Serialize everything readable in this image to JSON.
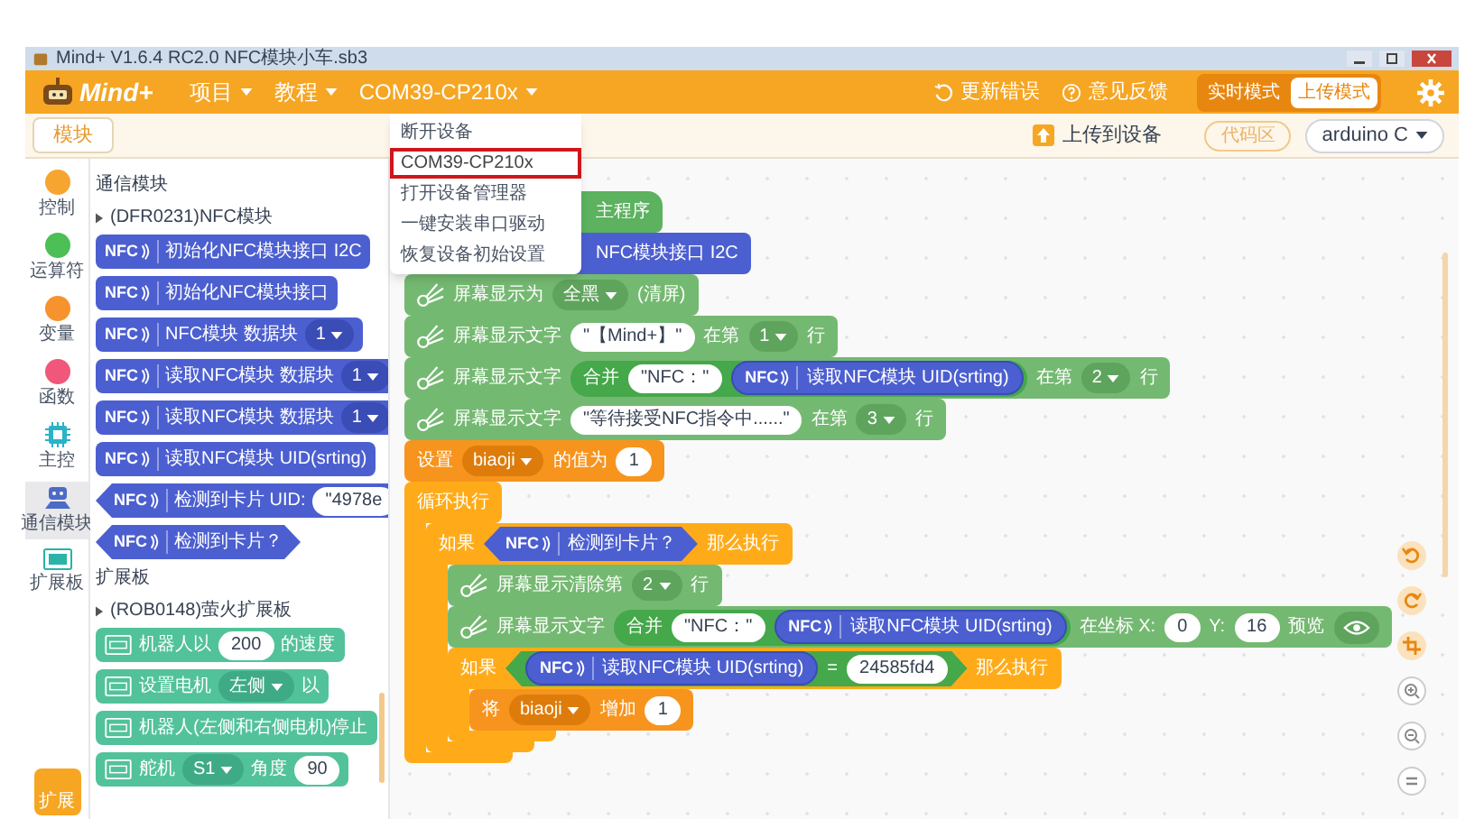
{
  "window": {
    "title": "Mind+ V1.6.4 RC2.0  NFC模块小车.sb3"
  },
  "menu_bar": {
    "logo": "Mind+",
    "items": [
      {
        "label": "项目"
      },
      {
        "label": "教程"
      },
      {
        "label": "COM39-CP210x"
      }
    ],
    "actions": [
      {
        "kind": "refresh",
        "label": "更新错误"
      },
      {
        "kind": "help",
        "label": "意见反馈"
      }
    ],
    "modes": [
      {
        "label": "实时模式",
        "selected": false
      },
      {
        "label": "上传模式",
        "selected": true
      }
    ]
  },
  "device_menu": {
    "items": [
      {
        "label": "断开设备",
        "selected": false
      },
      {
        "label": "COM39-CP210x",
        "selected": true
      },
      {
        "label": "打开设备管理器",
        "selected": false
      },
      {
        "label": "一键安装串口驱动",
        "selected": false
      },
      {
        "label": "恢复设备初始设置",
        "selected": false
      }
    ]
  },
  "toolbar": {
    "tab": "模块",
    "upload": "上传到设备",
    "code": "代码区",
    "language": "arduino C"
  },
  "categories": [
    {
      "label": "控制",
      "kind": "dot",
      "color": "#f7a531",
      "selected": false
    },
    {
      "label": "运算符",
      "kind": "dot",
      "color": "#4cbf56",
      "selected": false
    },
    {
      "label": "变量",
      "kind": "dot",
      "color": "#f7932d",
      "selected": false
    },
    {
      "label": "函数",
      "kind": "dot",
      "color": "#f0577a",
      "selected": false
    },
    {
      "label": "主控",
      "kind": "chip",
      "color": "#2ab3c7",
      "selected": false
    },
    {
      "label": "通信模块",
      "kind": "robot",
      "color": "#4c6bc5",
      "selected": true
    },
    {
      "label": "扩展板",
      "kind": "board",
      "color": "#2ab3a6",
      "selected": false
    }
  ],
  "palette": {
    "sections": [
      {
        "title": "通信模块",
        "groups": [
          {
            "title": "(DFR0231)NFC模块",
            "blocks": [
              {
                "kind": "nfc",
                "parts": [
                  {
                    "kind": "badge",
                    "text": "NFC"
                  },
                  {
                    "kind": "text",
                    "text": "初始化NFC模块接口 I2C"
                  }
                ]
              },
              {
                "kind": "nfc",
                "parts": [
                  {
                    "kind": "badge",
                    "text": "NFC"
                  },
                  {
                    "kind": "text",
                    "text": "初始化NFC模块接口"
                  }
                ]
              },
              {
                "kind": "nfc",
                "parts": [
                  {
                    "kind": "badge",
                    "text": "NFC"
                  },
                  {
                    "kind": "text",
                    "text": "NFC模块 数据块"
                  },
                  {
                    "kind": "dropdown",
                    "text": "1"
                  }
                ]
              },
              {
                "kind": "nfc",
                "parts": [
                  {
                    "kind": "badge",
                    "text": "NFC"
                  },
                  {
                    "kind": "text",
                    "text": "读取NFC模块 数据块"
                  },
                  {
                    "kind": "dropdown",
                    "text": "1"
                  }
                ]
              },
              {
                "kind": "nfc",
                "parts": [
                  {
                    "kind": "badge",
                    "text": "NFC"
                  },
                  {
                    "kind": "text",
                    "text": "读取NFC模块 数据块"
                  },
                  {
                    "kind": "dropdown",
                    "text": "1"
                  }
                ]
              },
              {
                "kind": "nfc",
                "parts": [
                  {
                    "kind": "badge",
                    "text": "NFC"
                  },
                  {
                    "kind": "text",
                    "text": "读取NFC模块 UID(srting)"
                  }
                ]
              },
              {
                "kind": "nfc_bool",
                "parts": [
                  {
                    "kind": "badge",
                    "text": "NFC"
                  },
                  {
                    "kind": "text",
                    "text": "检测到卡片 UID:"
                  },
                  {
                    "kind": "string",
                    "text": "\"4978e"
                  }
                ]
              },
              {
                "kind": "nfc_bool",
                "parts": [
                  {
                    "kind": "badge",
                    "text": "NFC"
                  },
                  {
                    "kind": "text",
                    "text": "检测到卡片？"
                  }
                ]
              }
            ]
          }
        ]
      },
      {
        "title": "扩展板",
        "groups": [
          {
            "title": "(ROB0148)萤火扩展板",
            "blocks": [
              {
                "kind": "ext",
                "parts": [
                  {
                    "kind": "icon"
                  },
                  {
                    "kind": "text",
                    "text": "机器人以"
                  },
                  {
                    "kind": "number",
                    "text": "200"
                  },
                  {
                    "kind": "text",
                    "text": "的速度"
                  }
                ]
              },
              {
                "kind": "ext",
                "parts": [
                  {
                    "kind": "icon"
                  },
                  {
                    "kind": "text",
                    "text": "设置电机"
                  },
                  {
                    "kind": "dropdown",
                    "text": "左侧"
                  },
                  {
                    "kind": "text",
                    "text": "以"
                  }
                ]
              },
              {
                "kind": "ext",
                "parts": [
                  {
                    "kind": "icon"
                  },
                  {
                    "kind": "text",
                    "text": "机器人(左侧和右侧电机)停止"
                  }
                ]
              },
              {
                "kind": "ext",
                "parts": [
                  {
                    "kind": "icon"
                  },
                  {
                    "kind": "text",
                    "text": "舵机"
                  },
                  {
                    "kind": "dropdown",
                    "text": "S1"
                  },
                  {
                    "kind": "text",
                    "text": "角度"
                  },
                  {
                    "kind": "number",
                    "text": "90"
                  }
                ]
              }
            ]
          }
        ]
      }
    ]
  },
  "extensions_button": "扩展",
  "canvas": {
    "blocks": [
      {
        "kind": "event",
        "covered": true,
        "parts": [
          {
            "kind": "text",
            "text": "主程序"
          }
        ]
      },
      {
        "kind": "nfc",
        "covered": true,
        "parts": [
          {
            "kind": "text",
            "text": "NFC模块接口 I2C"
          }
        ]
      },
      {
        "kind": "oled",
        "parts": [
          {
            "kind": "icon"
          },
          {
            "kind": "text",
            "text": "屏幕显示为"
          },
          {
            "kind": "dropdown",
            "text": "全黑"
          },
          {
            "kind": "text",
            "text": "(清屏)"
          }
        ]
      },
      {
        "kind": "oled",
        "parts": [
          {
            "kind": "icon"
          },
          {
            "kind": "text",
            "text": "屏幕显示文字"
          },
          {
            "kind": "string",
            "text": "\"【Mind+】\""
          },
          {
            "kind": "text",
            "text": "在第"
          },
          {
            "kind": "dropdown",
            "text": "1"
          },
          {
            "kind": "text",
            "text": "行"
          }
        ]
      },
      {
        "kind": "oled",
        "parts": [
          {
            "kind": "icon"
          },
          {
            "kind": "text",
            "text": "屏幕显示文字"
          },
          {
            "kind": "join",
            "parts": [
              {
                "kind": "text",
                "text": "合并"
              },
              {
                "kind": "string",
                "text": "\"NFC：\""
              },
              {
                "kind": "reporter",
                "parts": [
                  {
                    "kind": "badge",
                    "text": "NFC"
                  },
                  {
                    "kind": "text",
                    "text": "读取NFC模块 UID(srting)"
                  }
                ]
              }
            ]
          },
          {
            "kind": "text",
            "text": "在第"
          },
          {
            "kind": "dropdown",
            "text": "2"
          },
          {
            "kind": "text",
            "text": "行"
          }
        ]
      },
      {
        "kind": "oled",
        "parts": [
          {
            "kind": "icon"
          },
          {
            "kind": "text",
            "text": "屏幕显示文字"
          },
          {
            "kind": "string",
            "text": "\"等待接受NFC指令中......\""
          },
          {
            "kind": "text",
            "text": "在第"
          },
          {
            "kind": "dropdown",
            "text": "3"
          },
          {
            "kind": "text",
            "text": "行"
          }
        ]
      },
      {
        "kind": "variable",
        "parts": [
          {
            "kind": "text",
            "text": "设置"
          },
          {
            "kind": "dropdown",
            "text": "biaoji"
          },
          {
            "kind": "text",
            "text": "的值为"
          },
          {
            "kind": "number",
            "text": "1"
          }
        ]
      },
      {
        "kind": "control",
        "parts": [
          {
            "kind": "text",
            "text": "循环执行"
          }
        ],
        "children": [
          {
            "kind": "control",
            "parts": [
              {
                "kind": "text",
                "text": "如果"
              },
              {
                "kind": "bool",
                "parts": [
                  {
                    "kind": "badge",
                    "text": "NFC"
                  },
                  {
                    "kind": "text",
                    "text": "检测到卡片？"
                  }
                ]
              },
              {
                "kind": "text",
                "text": "那么执行"
              }
            ],
            "children": [
              {
                "kind": "oled",
                "parts": [
                  {
                    "kind": "icon"
                  },
                  {
                    "kind": "text",
                    "text": "屏幕显示清除第"
                  },
                  {
                    "kind": "dropdown",
                    "text": "2"
                  },
                  {
                    "kind": "text",
                    "text": "行"
                  }
                ]
              },
              {
                "kind": "oled",
                "parts": [
                  {
                    "kind": "icon"
                  },
                  {
                    "kind": "text",
                    "text": "屏幕显示文字"
                  },
                  {
                    "kind": "join",
                    "parts": [
                      {
                        "kind": "text",
                        "text": "合并"
                      },
                      {
                        "kind": "string",
                        "text": "\"NFC：\""
                      },
                      {
                        "kind": "reporter",
                        "parts": [
                          {
                            "kind": "badge",
                            "text": "NFC"
                          },
                          {
                            "kind": "text",
                            "text": "读取NFC模块 UID(srting)"
                          }
                        ]
                      }
                    ]
                  },
                  {
                    "kind": "text",
                    "text": "在坐标 X:"
                  },
                  {
                    "kind": "number",
                    "text": "0"
                  },
                  {
                    "kind": "text",
                    "text": "Y:"
                  },
                  {
                    "kind": "number",
                    "text": "16"
                  },
                  {
                    "kind": "text",
                    "text": "预览"
                  },
                  {
                    "kind": "eye"
                  }
                ]
              },
              {
                "kind": "control",
                "parts": [
                  {
                    "kind": "text",
                    "text": "如果"
                  },
                  {
                    "kind": "compare",
                    "parts": [
                      {
                        "kind": "reporter",
                        "parts": [
                          {
                            "kind": "badge",
                            "text": "NFC"
                          },
                          {
                            "kind": "text",
                            "text": "读取NFC模块 UID(srting)"
                          }
                        ]
                      },
                      {
                        "kind": "text",
                        "text": "="
                      },
                      {
                        "kind": "number",
                        "text": "24585fd4"
                      }
                    ]
                  },
                  {
                    "kind": "text",
                    "text": "那么执行"
                  }
                ],
                "children": [
                  {
                    "kind": "variable",
                    "parts": [
                      {
                        "kind": "text",
                        "text": "将"
                      },
                      {
                        "kind": "dropdown",
                        "text": "biaoji"
                      },
                      {
                        "kind": "text",
                        "text": "增加"
                      },
                      {
                        "kind": "number",
                        "text": "1"
                      }
                    ]
                  }
                ]
              }
            ]
          }
        ]
      }
    ]
  }
}
